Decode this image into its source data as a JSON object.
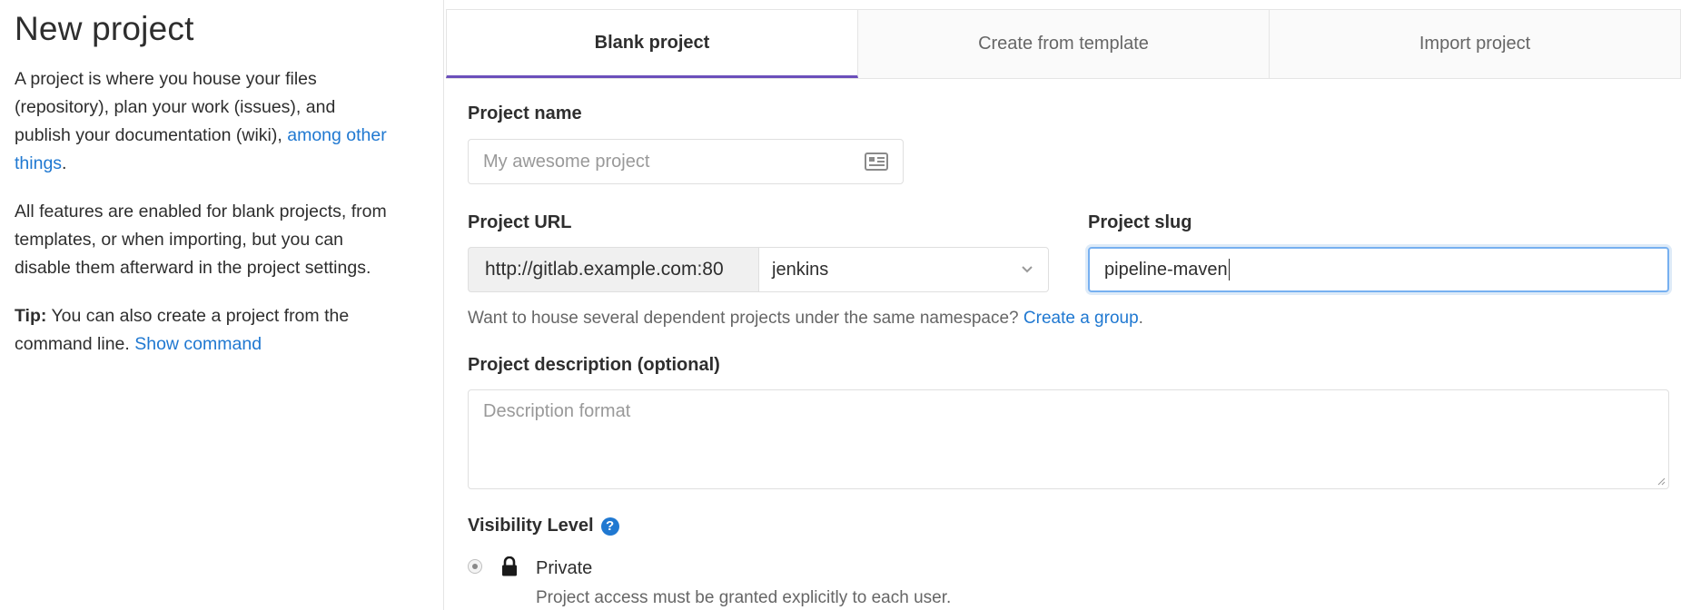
{
  "sidebar": {
    "title": "New project",
    "intro_text": "A project is where you house your files (repository), plan your work (issues), and publish your documentation (wiki), ",
    "intro_link": "among other things",
    "intro_suffix": ".",
    "features_text": "All features are enabled for blank projects, from templates, or when importing, but you can disable them afterward in the project settings.",
    "tip_label": "Tip:",
    "tip_text": " You can also create a project from the command line. ",
    "tip_link": "Show command"
  },
  "tabs": [
    {
      "label": "Blank project",
      "active": true
    },
    {
      "label": "Create from template",
      "active": false
    },
    {
      "label": "Import project",
      "active": false
    }
  ],
  "form": {
    "project_name": {
      "label": "Project name",
      "placeholder": "My awesome project",
      "value": ""
    },
    "project_url": {
      "label": "Project URL",
      "prefix": "http://gitlab.example.com:80",
      "namespace": "jenkins"
    },
    "project_slug": {
      "label": "Project slug",
      "value": "pipeline-maven"
    },
    "namespace_help": {
      "text": "Want to house several dependent projects under the same namespace? ",
      "link": "Create a group",
      "suffix": "."
    },
    "description": {
      "label": "Project description (optional)",
      "placeholder": "Description format"
    },
    "visibility": {
      "label": "Visibility Level",
      "help_glyph": "?",
      "options": [
        {
          "title": "Private",
          "description": "Project access must be granted explicitly to each user.",
          "icon": "lock-icon",
          "selected": true
        }
      ]
    }
  },
  "colors": {
    "link": "#1f78d1",
    "active_tab_border": "#6b4fbb",
    "focus_border": "#77b0f0"
  }
}
